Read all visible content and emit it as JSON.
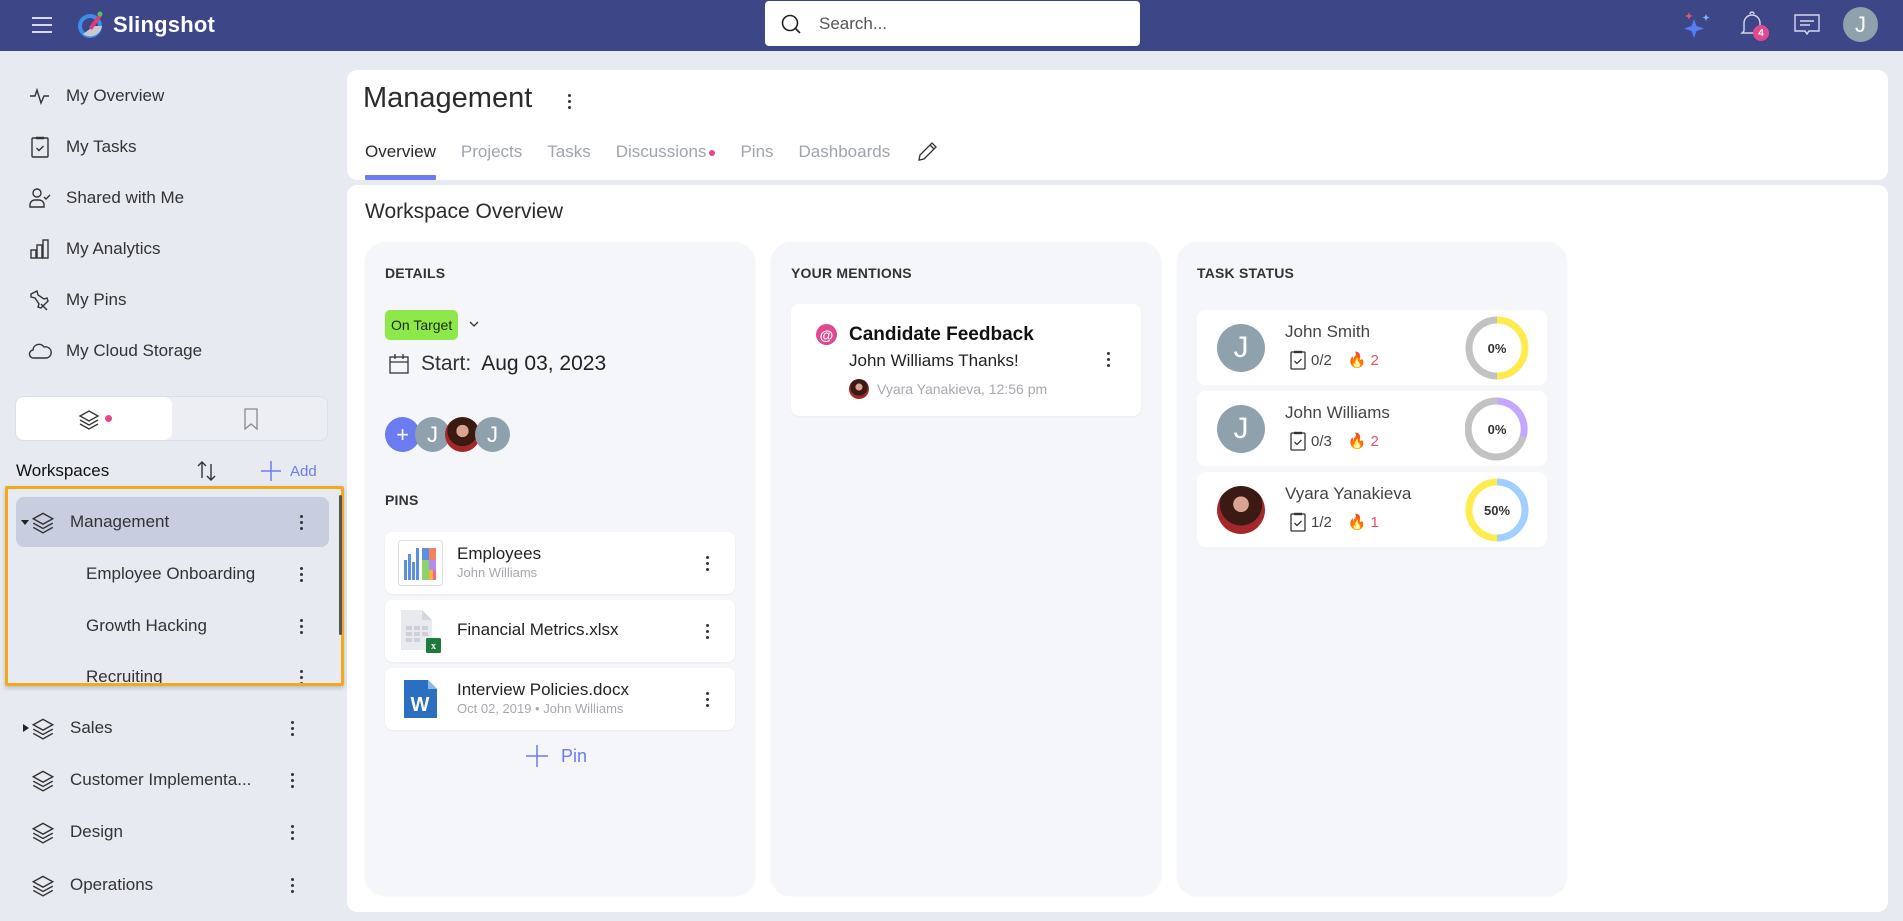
{
  "app": {
    "name": "Slingshot",
    "colors": {
      "topbar": "#3d4687",
      "accent": "#6a7cf0",
      "badge": "#e0498f",
      "status_on_target": "#8fe84a",
      "focus_outline": "#f3a91c"
    }
  },
  "topbar": {
    "search_placeholder": "Search...",
    "notifications_count": "4",
    "user_initial": "J",
    "icons": [
      "menu-icon",
      "ai-sparkle-icon",
      "bell-icon",
      "chat-icon"
    ]
  },
  "sidebar": {
    "nav": [
      {
        "label": "My Overview",
        "icon": "activity-icon"
      },
      {
        "label": "My Tasks",
        "icon": "clipboard-check-icon"
      },
      {
        "label": "Shared with Me",
        "icon": "user-check-icon"
      },
      {
        "label": "My Analytics",
        "icon": "bar-chart-icon"
      },
      {
        "label": "My Pins",
        "icon": "pin-icon"
      },
      {
        "label": "My Cloud Storage",
        "icon": "cloud-icon"
      }
    ],
    "toggle": {
      "active": "workspaces",
      "options": [
        "workspaces",
        "bookmarks"
      ]
    },
    "workspaces_title": "Workspaces",
    "add_label": "Add",
    "workspaces": [
      {
        "label": "Management",
        "expanded": true,
        "selected": true,
        "children": [
          "Employee Onboarding",
          "Growth Hacking",
          "Recruiting"
        ]
      },
      {
        "label": "Sales",
        "expanded": false
      },
      {
        "label": "Customer Implementa..."
      },
      {
        "label": "Design"
      },
      {
        "label": "Operations"
      }
    ]
  },
  "header": {
    "title": "Management",
    "tabs": [
      {
        "label": "Overview",
        "active": true
      },
      {
        "label": "Projects"
      },
      {
        "label": "Tasks"
      },
      {
        "label": "Discussions",
        "has_dot": true
      },
      {
        "label": "Pins"
      },
      {
        "label": "Dashboards"
      }
    ]
  },
  "overview": {
    "title": "Workspace Overview",
    "details": {
      "label": "DETAILS",
      "status": "On Target",
      "start_prefix": "Start:",
      "start_date": "Aug 03, 2023",
      "members": [
        "J",
        "photo",
        "J"
      ]
    },
    "pins": {
      "label": "PINS",
      "items": [
        {
          "title": "Employees",
          "subtitle": "John Williams",
          "type": "dashboard"
        },
        {
          "title": "Financial Metrics.xlsx",
          "subtitle": "",
          "type": "excel"
        },
        {
          "title": "Interview Policies.docx",
          "subtitle": "Oct 02, 2019 • John Williams",
          "type": "word"
        }
      ],
      "add_label": "Pin"
    },
    "mentions": {
      "label": "YOUR MENTIONS",
      "items": [
        {
          "title": "Candidate Feedback",
          "body": "John Williams Thanks!",
          "meta": "Vyara Yanakieva, 12:56 pm"
        }
      ]
    },
    "task_status": {
      "label": "TASK STATUS",
      "people": [
        {
          "name": "John Smith",
          "initial": "J",
          "done": "0/2",
          "overdue": "2",
          "percent_label": "0%",
          "percent": 0,
          "ring": [
            "#c2c2c2",
            "#ffeb4d"
          ]
        },
        {
          "name": "John Williams",
          "initial": "J",
          "done": "0/3",
          "overdue": "2",
          "percent_label": "0%",
          "percent": 0,
          "ring": [
            "#c2c2c2",
            "#c4a8ff"
          ]
        },
        {
          "name": "Vyara Yanakieva",
          "initial": "",
          "photo": true,
          "done": "1/2",
          "overdue": "1",
          "percent_label": "50%",
          "percent": 50,
          "ring": [
            "#ffeb4d",
            "#9fd0ff"
          ]
        }
      ]
    }
  }
}
